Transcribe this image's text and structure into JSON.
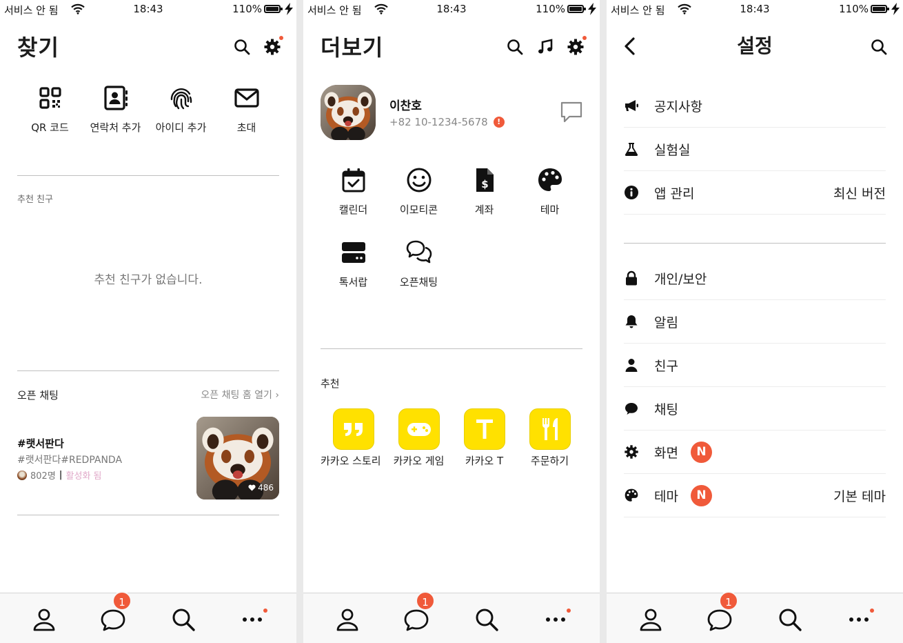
{
  "status": {
    "carrier": "서비스 안 됨",
    "time": "18:43",
    "battery": "110%"
  },
  "find": {
    "title": "찾기",
    "actions": [
      {
        "label": "QR 코드",
        "icon": "qr-code-icon"
      },
      {
        "label": "연락처 추가",
        "icon": "contact-book-icon"
      },
      {
        "label": "아이디 추가",
        "icon": "fingerprint-icon"
      },
      {
        "label": "초대",
        "icon": "envelope-icon"
      }
    ],
    "recommended_label": "추천 친구",
    "empty_message": "추천 친구가 없습니다.",
    "open_chat_label": "오픈 채팅",
    "open_chat_link": "오픈 채팅 홈 열기",
    "room": {
      "title": "#랫서판다",
      "tag": "#랫서판다#REDPANDA",
      "members": "802명",
      "status": "활성화 됨",
      "likes": "486"
    }
  },
  "more": {
    "title": "더보기",
    "profile": {
      "name": "이찬호",
      "phone": "+82 10-1234-5678",
      "alert": "!"
    },
    "services": [
      {
        "label": "캘린더",
        "icon": "calendar-icon"
      },
      {
        "label": "이모티콘",
        "icon": "smiley-icon"
      },
      {
        "label": "계좌",
        "icon": "dollar-document-icon"
      },
      {
        "label": "테마",
        "icon": "palette-icon"
      },
      {
        "label": "톡서랍",
        "icon": "drawer-icon"
      },
      {
        "label": "오픈채팅",
        "icon": "chat-bubbles-icon"
      }
    ],
    "recommend_label": "추천",
    "recommend": [
      {
        "label": "카카오 스토리",
        "icon": "quote-icon"
      },
      {
        "label": "카카오 게임",
        "icon": "gamepad-icon"
      },
      {
        "label": "카카오 T",
        "icon": "letter-t-icon"
      },
      {
        "label": "주문하기",
        "icon": "fork-knife-icon"
      }
    ]
  },
  "settings": {
    "title": "설정",
    "group1": [
      {
        "label": "공지사항",
        "icon": "megaphone-icon"
      },
      {
        "label": "실험실",
        "icon": "flask-icon"
      },
      {
        "label": "앱 관리",
        "icon": "info-icon",
        "value": "최신 버전"
      }
    ],
    "group2": [
      {
        "label": "개인/보안",
        "icon": "lock-icon"
      },
      {
        "label": "알림",
        "icon": "bell-icon"
      },
      {
        "label": "친구",
        "icon": "person-icon"
      },
      {
        "label": "채팅",
        "icon": "chat-icon"
      },
      {
        "label": "화면",
        "icon": "gear-icon",
        "badge": "N"
      },
      {
        "label": "테마",
        "icon": "palette-icon",
        "badge": "N",
        "value": "기본 테마"
      }
    ]
  },
  "tabbar": {
    "chat_badge": "1"
  },
  "colors": {
    "accent": "#f05a3a",
    "kakao_yellow": "#ffe100",
    "divider": "#bfbfbf"
  }
}
